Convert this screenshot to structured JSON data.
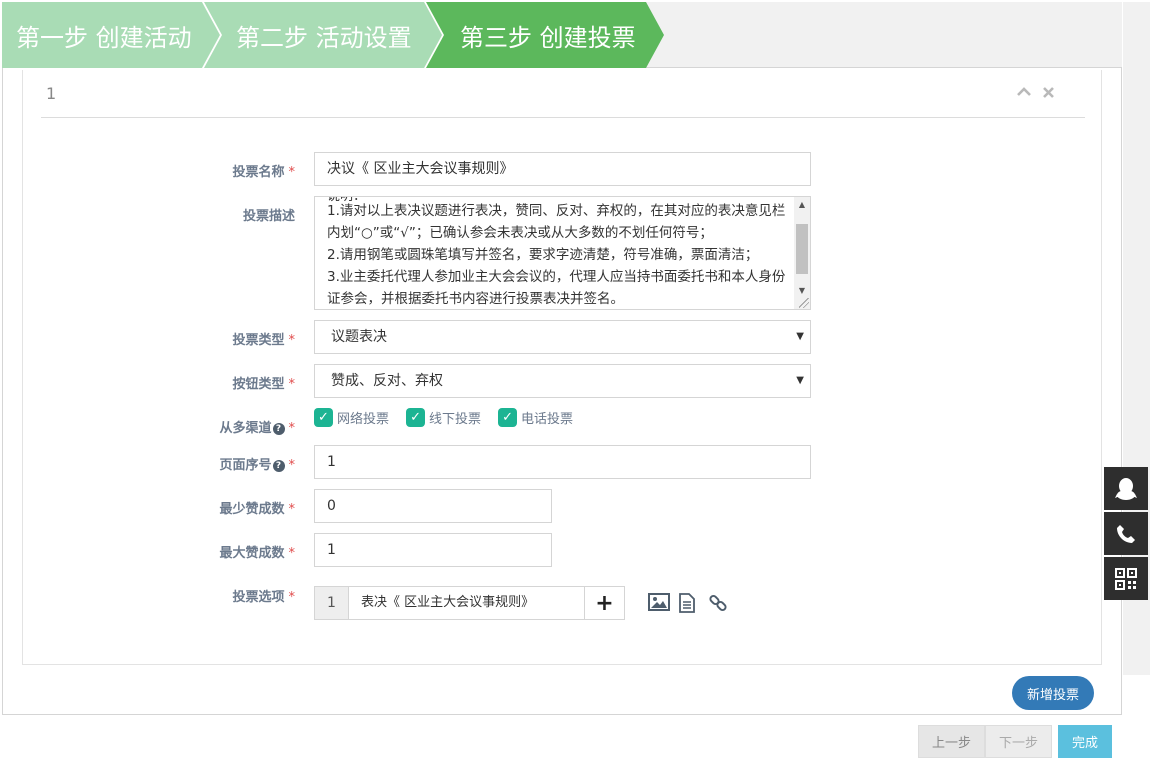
{
  "steps": [
    {
      "label": "第一步 创建活动"
    },
    {
      "label": "第二步 活动设置"
    },
    {
      "label": "第三步 创建投票"
    }
  ],
  "panel": {
    "title": "1"
  },
  "form": {
    "vote_name": {
      "label": "投票名称",
      "value": "决议《 区业主大会议事规则》"
    },
    "vote_desc": {
      "label": "投票描述",
      "clipped_line": "说明：",
      "lines": [
        "1.请对以上表决议题进行表决，赞同、反对、弃权的，在其对应的表决意见栏内划“○”或“√”；已确认参会未表决或从大多数的不划任何符号；",
        "2.请用钢笔或圆珠笔填写并签名，要求字迹清楚，符号准确，票面清洁；",
        "3.业主委托代理人参加业主大会会议的，代理人应当持书面委托书和本人身份证参会，并根据委托书内容进行投票表决并签名。"
      ]
    },
    "vote_type": {
      "label": "投票类型",
      "value": "议题表决"
    },
    "button_type": {
      "label": "按钮类型",
      "value": "赞成、反对、弃权"
    },
    "channels": {
      "label": "从多渠道",
      "options": [
        "网络投票",
        "线下投票",
        "电话投票"
      ]
    },
    "page_no": {
      "label": "页面序号",
      "value": "1"
    },
    "min_approve": {
      "label": "最少赞成数",
      "value": "0"
    },
    "max_approve": {
      "label": "最大赞成数",
      "value": "1"
    },
    "vote_options": {
      "label": "投票选项",
      "items": [
        {
          "number": "1",
          "text": "表决《 区业主大会议事规则》"
        }
      ]
    }
  },
  "buttons": {
    "add_vote": "新增投票",
    "prev": "上一步",
    "next": "下一步",
    "done": "完成"
  },
  "icons": {
    "required": "*",
    "help": "?",
    "check": "✓",
    "plus": "+",
    "collapse": "^",
    "close": "×"
  },
  "colors": {
    "step_active": "#5cb85c",
    "step_inactive": "#a9dcb5",
    "checkbox": "#1cb493",
    "primary": "#337ab7",
    "info": "#5bc0de"
  }
}
